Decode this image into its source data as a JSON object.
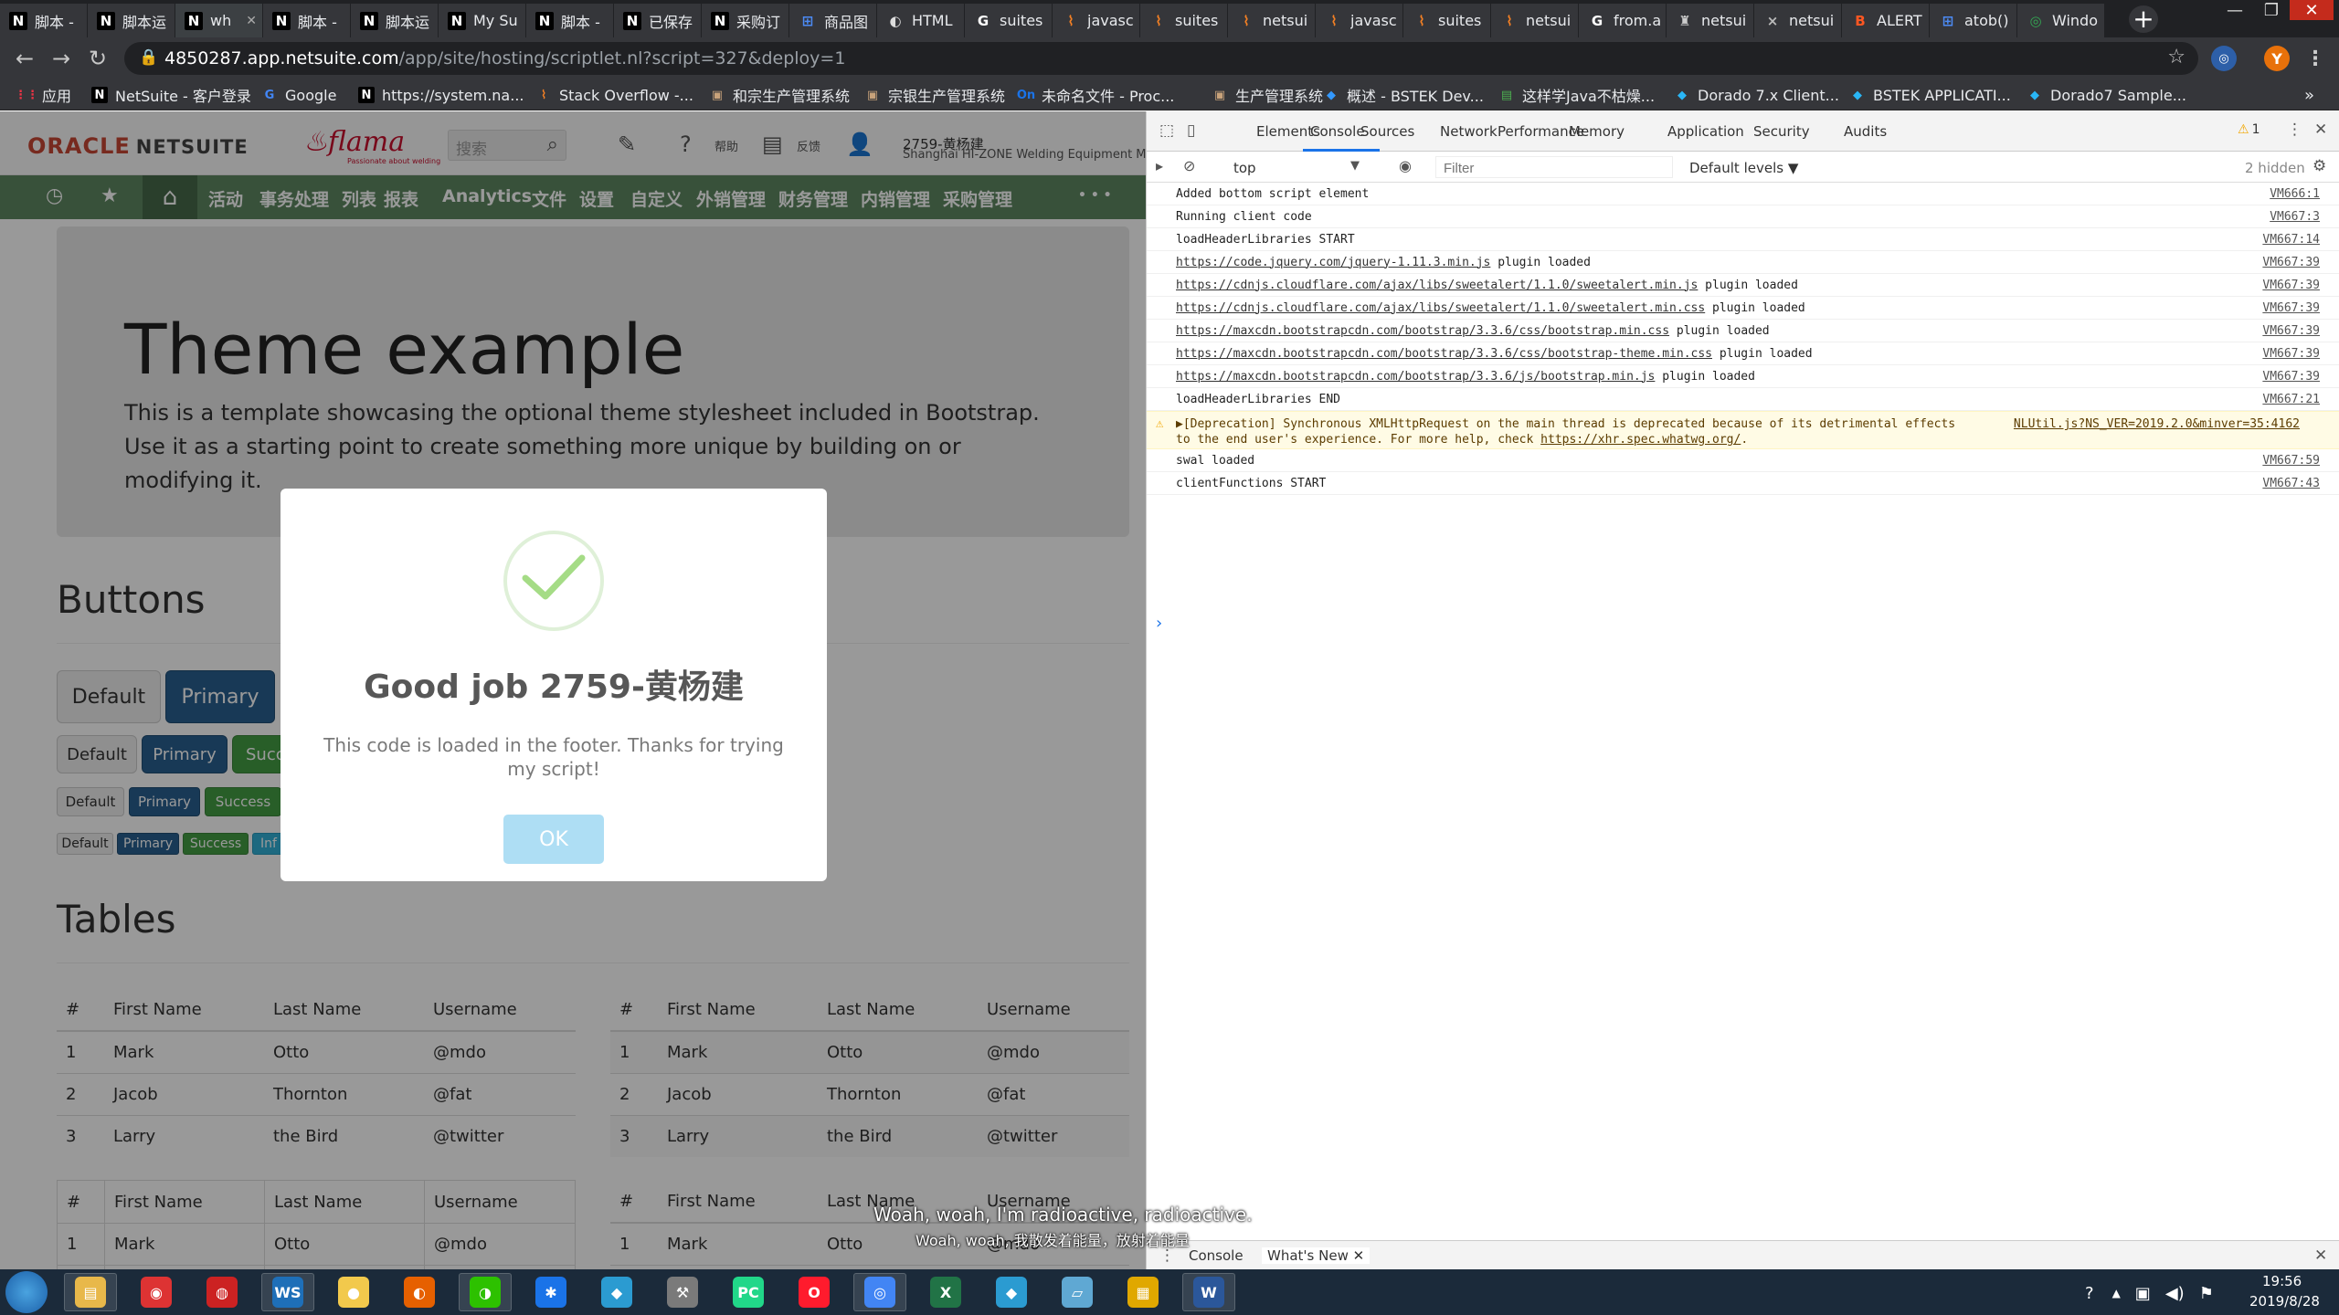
{
  "browser": {
    "tabs": [
      {
        "title": "脚本 -",
        "icon": "N"
      },
      {
        "title": "脚本运",
        "icon": "N"
      },
      {
        "title": "wh",
        "icon": "N",
        "active": true
      },
      {
        "title": "脚本 -",
        "icon": "N"
      },
      {
        "title": "脚本运",
        "icon": "N"
      },
      {
        "title": "My Su",
        "icon": "N"
      },
      {
        "title": "脚本 -",
        "icon": "N"
      },
      {
        "title": "已保存",
        "icon": "N"
      },
      {
        "title": "采购订",
        "icon": "N"
      },
      {
        "title": "商品图",
        "icon": "⊞"
      },
      {
        "title": "HTML",
        "icon": "◐"
      },
      {
        "title": "suites",
        "icon": "G"
      },
      {
        "title": "javasc",
        "icon": "⌇"
      },
      {
        "title": "suites",
        "icon": "⌇"
      },
      {
        "title": "netsui",
        "icon": "⌇"
      },
      {
        "title": "javasc",
        "icon": "⌇"
      },
      {
        "title": "suites",
        "icon": "⌇"
      },
      {
        "title": "netsui",
        "icon": "⌇"
      },
      {
        "title": "from.a",
        "icon": "G"
      },
      {
        "title": "netsui",
        "icon": "♜"
      },
      {
        "title": "netsui",
        "icon": "×"
      },
      {
        "title": "ALERT",
        "icon": "B"
      },
      {
        "title": "atob()",
        "icon": "⊞"
      },
      {
        "title": "Windo",
        "icon": "◎"
      }
    ],
    "url_host": "4850287.app.netsuite.com",
    "url_path": "/app/site/hosting/scriptlet.nl?script=327&deploy=1",
    "bookmarks": [
      {
        "label": "应用",
        "icon": "⋮⋮"
      },
      {
        "label": "NetSuite - 客户登录",
        "icon": "N"
      },
      {
        "label": "Google",
        "icon": "G"
      },
      {
        "label": "https://system.na...",
        "icon": "N"
      },
      {
        "label": "Stack Overflow -...",
        "icon": "⌇"
      },
      {
        "label": "和宗生产管理系统",
        "icon": "▣"
      },
      {
        "label": "宗银生产管理系统",
        "icon": "▣"
      },
      {
        "label": "未命名文件 - Proc...",
        "icon": "On"
      },
      {
        "label": "生产管理系统",
        "icon": "▣"
      },
      {
        "label": "概述 - BSTEK Dev...",
        "icon": "◆"
      },
      {
        "label": "这样学Java不枯燥...",
        "icon": "▤"
      },
      {
        "label": "Dorado 7.x Client...",
        "icon": "◆"
      },
      {
        "label": "BSTEK APPLICATI...",
        "icon": "◆"
      },
      {
        "label": "Dorado7 Sample...",
        "icon": "◆"
      }
    ],
    "bookmarks_more": "»",
    "ext_avatar": "Y"
  },
  "netsuite": {
    "brand": "ORACLE",
    "product": "NETSUITE",
    "company_logo": "flama",
    "company_tagline": "Passionate about welding",
    "search_placeholder": "搜索",
    "help_label": "帮助",
    "feedback_label": "反馈",
    "user_name": "2759-黄杨建",
    "user_company": "Shanghai HI-ZONE Welding Equipment Ma",
    "nav": [
      "活动",
      "事务处理",
      "列表",
      "报表",
      "Analytics",
      "文件",
      "设置",
      "自定义",
      "外销管理",
      "财务管理",
      "内销管理",
      "采购管理"
    ],
    "nav_more": "• • •"
  },
  "page": {
    "jumbotron_title": "Theme example",
    "jumbotron_text": "This is a template showcasing the optional theme stylesheet included in Bootstrap. Use it as a starting point to create something more unique by building on or modifying it.",
    "buttons_heading": "Buttons",
    "tables_heading": "Tables",
    "btn_default": "Default",
    "btn_primary": "Primary",
    "btn_success": "Success",
    "btn_success_cut": "Succ",
    "btn_info_cut": "Inf",
    "table_headers": [
      "#",
      "First Name",
      "Last Name",
      "Username"
    ],
    "table_rows": [
      [
        "1",
        "Mark",
        "Otto",
        "@mdo"
      ],
      [
        "2",
        "Jacob",
        "Thornton",
        "@fat"
      ],
      [
        "3",
        "Larry",
        "the Bird",
        "@twitter"
      ]
    ]
  },
  "modal": {
    "title": "Good job 2759-黄杨建",
    "text": "This code is loaded in the footer. Thanks for trying my script!",
    "ok_label": "OK",
    "check_color": "#a5dc86"
  },
  "devtools": {
    "tabs": [
      "Elements",
      "Console",
      "Sources",
      "Network",
      "Performance",
      "Memory",
      "Application",
      "Security",
      "Audits"
    ],
    "active_tab": "Console",
    "warning_count": "1",
    "context": "top",
    "filter_placeholder": "Filter",
    "levels": "Default levels ▼",
    "hidden": "2 hidden",
    "log": [
      {
        "text": "Added bottom script element",
        "src": "VM666:1"
      },
      {
        "text": "Running client code",
        "src": "VM667:3"
      },
      {
        "text": "loadHeaderLibraries START",
        "src": "VM667:14"
      },
      {
        "link": "https://code.jquery.com/jquery-1.11.3.min.js",
        "text": " plugin loaded",
        "src": "VM667:39"
      },
      {
        "link": "https://cdnjs.cloudflare.com/ajax/libs/sweetalert/1.1.0/sweetalert.min.js",
        "text": " plugin loaded",
        "src": "VM667:39"
      },
      {
        "link": "https://cdnjs.cloudflare.com/ajax/libs/sweetalert/1.1.0/sweetalert.min.css",
        "text": " plugin loaded",
        "src": "VM667:39"
      },
      {
        "link": "https://maxcdn.bootstrapcdn.com/bootstrap/3.3.6/css/bootstrap.min.css",
        "text": " plugin loaded",
        "src": "VM667:39"
      },
      {
        "link": "https://maxcdn.bootstrapcdn.com/bootstrap/3.3.6/css/bootstrap-theme.min.css",
        "text": " plugin loaded",
        "src": "VM667:39"
      },
      {
        "link": "https://maxcdn.bootstrapcdn.com/bootstrap/3.3.6/js/bootstrap.min.js",
        "text": " plugin loaded",
        "src": "VM667:39"
      },
      {
        "text": "loadHeaderLibraries END",
        "src": "VM667:21"
      }
    ],
    "warning_line1": "▶[Deprecation] Synchronous XMLHttpRequest on the main thread is deprecated because of its detrimental effects",
    "warning_src": "NLUtil.js?NS_VER=2019.2.0&minver=35:4162",
    "warning_line2_pre": "to the end user's experience. For more help, check ",
    "warning_line2_link": "https://xhr.spec.whatwg.org/",
    "warning_line2_post": ".",
    "log2": [
      {
        "text": "swal loaded",
        "src": "VM667:59"
      },
      {
        "text": "clientFunctions START",
        "src": "VM667:43"
      }
    ],
    "prompt": "›",
    "drawer_tabs": [
      "Console",
      "What's New"
    ]
  },
  "subtitles": {
    "line1": "Woah, woah, I'm radioactive, radioactive.",
    "line2": "Woah, woah, 我散发着能量，放射着能量"
  },
  "taskbar": {
    "time": "19:56",
    "date": "2019/8/28",
    "apps": [
      {
        "name": "file-explorer",
        "label": "▤",
        "color": "#e8b84a"
      },
      {
        "name": "netease-music",
        "label": "◉",
        "color": "#d33"
      },
      {
        "name": "netease-cloud",
        "label": "◍",
        "color": "#c22"
      },
      {
        "name": "webstorm",
        "label": "WS",
        "color": "#1e6fb8"
      },
      {
        "name": "qq-browser",
        "label": "●",
        "color": "#f2c94c"
      },
      {
        "name": "firefox",
        "label": "◐",
        "color": "#e66000"
      },
      {
        "name": "wechat",
        "label": "◑",
        "color": "#2dc100"
      },
      {
        "name": "star-app",
        "label": "✱",
        "color": "#1a73e8"
      },
      {
        "name": "bird-app",
        "label": "◆",
        "color": "#2b9bd1"
      },
      {
        "name": "tools-app",
        "label": "⚒",
        "color": "#7a7a7a"
      },
      {
        "name": "pycharm",
        "label": "PC",
        "color": "#21d789"
      },
      {
        "name": "opera",
        "label": "O",
        "color": "#ff1b2d"
      },
      {
        "name": "chrome",
        "label": "◎",
        "color": "#4285f4"
      },
      {
        "name": "excel",
        "label": "X",
        "color": "#217346"
      },
      {
        "name": "bird-app-2",
        "label": "◆",
        "color": "#2b9bd1"
      },
      {
        "name": "notepad",
        "label": "▱",
        "color": "#5fa8d3"
      },
      {
        "name": "archive-app",
        "label": "▦",
        "color": "#e0a800"
      },
      {
        "name": "word",
        "label": "W",
        "color": "#2b579a"
      }
    ]
  }
}
